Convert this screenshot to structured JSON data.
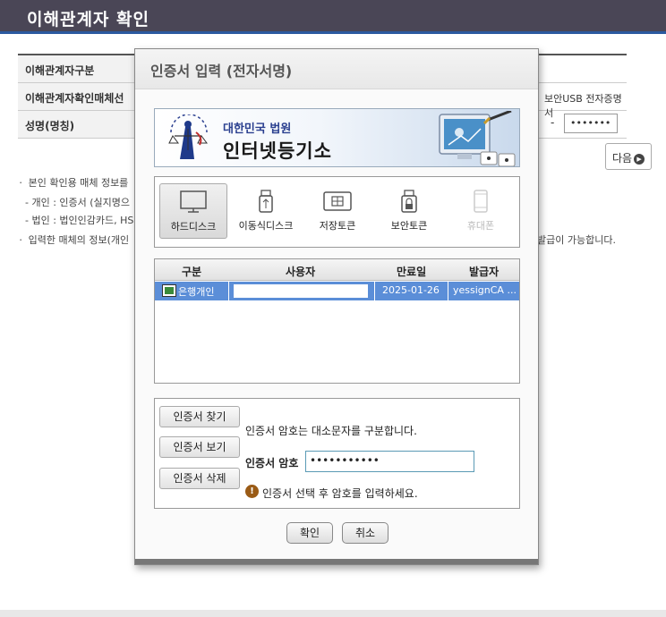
{
  "page": {
    "header_title": "이해관계자 확인",
    "table_rows": [
      {
        "label": "이해관계자구분",
        "value": ""
      },
      {
        "label": "이해관계자확인매체선",
        "value": "보안USB 전자증명서"
      },
      {
        "label": "성명(명칭)",
        "value": ""
      }
    ],
    "dash": "-",
    "masked_value": "•••••••",
    "next_button": "다음",
    "notes": [
      "ㆍ 본인 확인용 매체 정보를",
      "- 개인 : 인증서 (실지명으",
      "- 법인 : 법인인감카드, HS",
      "ㆍ 입력한 매체의 정보(개인"
    ],
    "note_right": "발급이 가능합니다."
  },
  "dialog": {
    "title": "인증서 입력 (전자서명)",
    "banner": {
      "small_text": "대한민국 법원",
      "big_text": "인터넷등기소"
    },
    "storage": [
      {
        "label": "하드디스크",
        "icon": "monitor-icon",
        "selected": true,
        "enabled": true
      },
      {
        "label": "이동식디스크",
        "icon": "usb-icon",
        "selected": false,
        "enabled": true
      },
      {
        "label": "저장토큰",
        "icon": "chip-card-icon",
        "selected": false,
        "enabled": true
      },
      {
        "label": "보안토큰",
        "icon": "lock-token-icon",
        "selected": false,
        "enabled": true
      },
      {
        "label": "휴대폰",
        "icon": "phone-icon",
        "selected": false,
        "enabled": false
      }
    ],
    "cert_table": {
      "columns": [
        "구분",
        "사용자",
        "만료일",
        "발급자"
      ],
      "rows": [
        {
          "type": "은행개인",
          "user": "",
          "expiry": "2025-01-26",
          "issuer": "yessignCA ..."
        }
      ]
    },
    "buttons": {
      "find": "인증서 찾기",
      "view": "인증서 보기",
      "delete": "인증서 삭제",
      "confirm": "확인",
      "cancel": "취소"
    },
    "case_note": "인증서 암호는 대소문자를 구분합니다.",
    "password_label": "인증서 암호",
    "password_value": "•••••••••••",
    "warning_text": "인증서 선택 후 암호를 입력하세요.",
    "colors": {
      "header_bg": "#4a4656",
      "selected_row": "#5b8ed8",
      "banner_text": "#2a3f8f"
    }
  }
}
